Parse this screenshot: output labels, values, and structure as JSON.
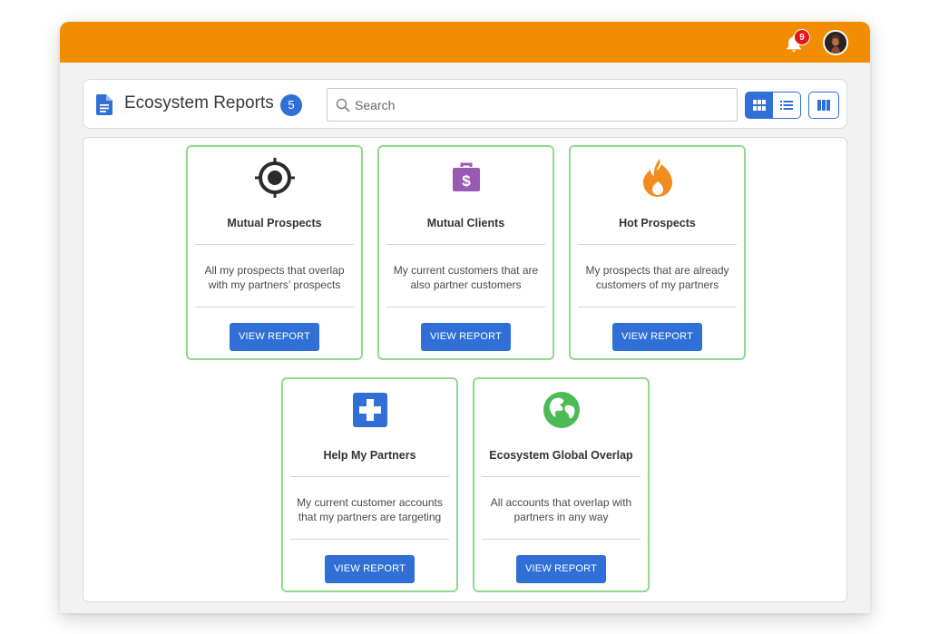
{
  "topbar": {
    "notification_count": "9",
    "icons": {
      "bell": "bell-icon",
      "avatar": "user-avatar"
    },
    "color": "#f28c00"
  },
  "header": {
    "title": "Ecosystem Reports",
    "report_count": "5",
    "search": {
      "placeholder": "Search",
      "value": ""
    },
    "view_buttons": [
      "grid-view-icon",
      "list-view-icon",
      "columns-view-icon"
    ]
  },
  "cards": [
    {
      "title": "Mutual Prospects",
      "description": "All my prospects that overlap with my partners’ prospects",
      "button": "VIEW REPORT",
      "icon": "target-icon"
    },
    {
      "title": "Mutual Clients",
      "description": "My current customers that are also partner customers",
      "button": "VIEW REPORT",
      "icon": "money-briefcase-icon"
    },
    {
      "title": "Hot Prospects",
      "description": "My prospects that are already customers of my partners",
      "button": "VIEW REPORT",
      "icon": "flame-icon"
    },
    {
      "title": "Help My Partners",
      "description": "My current customer accounts that my partners are targeting",
      "button": "VIEW REPORT",
      "icon": "plus-square-icon"
    },
    {
      "title": "Ecosystem Global Overlap",
      "description": "All accounts that overlap with partners in any way",
      "button": "VIEW REPORT",
      "icon": "globe-icon"
    }
  ],
  "colors": {
    "accent": "#2f6fd6",
    "card_border": "#8fd98f",
    "badge_red": "#e3161b",
    "icon_target": "#2b2b2b",
    "icon_briefcase": "#9b59b6",
    "icon_flame": "#f28c1e",
    "icon_plus": "#2f6fd6",
    "icon_globe": "#4cbb55"
  }
}
